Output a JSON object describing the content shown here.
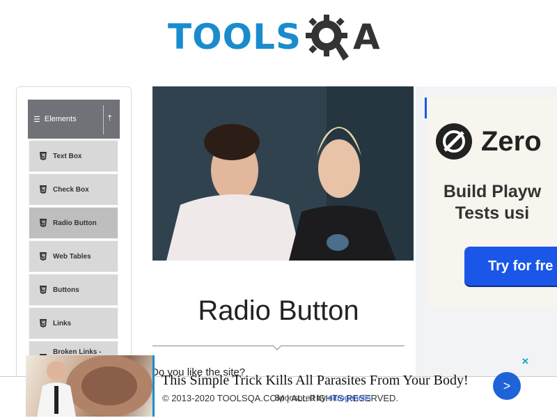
{
  "logo": {
    "text": "TOOLS",
    "suffix": "A",
    "brand_color": "#1a8ccd"
  },
  "sidebar": {
    "group_title": "Elements",
    "items": [
      {
        "label": "Text Box"
      },
      {
        "label": "Check Box"
      },
      {
        "label": "Radio Button",
        "active": true
      },
      {
        "label": "Web Tables"
      },
      {
        "label": "Buttons"
      },
      {
        "label": "Links"
      },
      {
        "label": "Broken Links -"
      }
    ],
    "icons": {
      "menu": "hamburger-icon",
      "collapse": "chevron-up-icon",
      "item": "html5-icon"
    }
  },
  "main": {
    "title": "Radio Button",
    "question": "Do you like the site?"
  },
  "right_ad": {
    "brand": "Zero",
    "tagline_line1": "Build Playw",
    "tagline_line2": "Tests usi",
    "cta": "Try for fre"
  },
  "footer": {
    "text": "© 2013-2020 TOOLSQA.COM | ALL RIGHTS RESERVED."
  },
  "bottom_ad": {
    "headline": "This Simple Trick Kills All Parasites From Your Body!",
    "sponsor_prefix": "Sponsored by",
    "sponsor_link": "nitrogenolis",
    "arrow": ">",
    "close": "✕"
  }
}
